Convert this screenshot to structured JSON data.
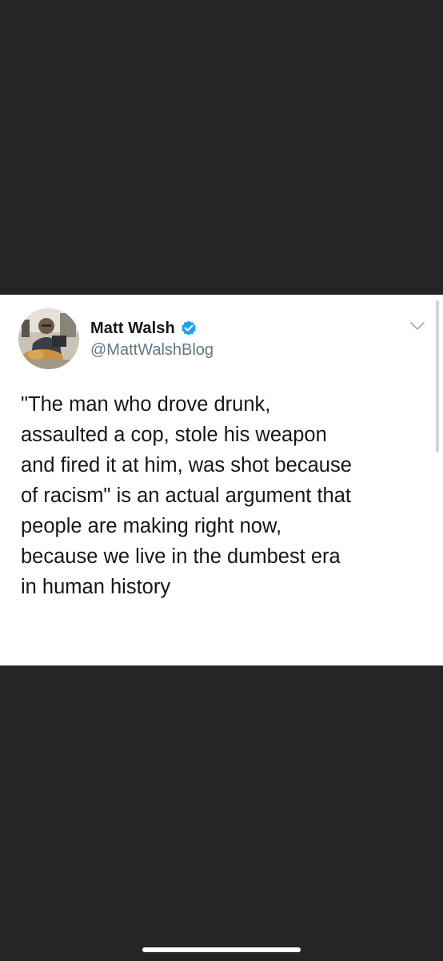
{
  "tweet": {
    "display_name": "Matt Walsh",
    "handle": "@MattWalshBlog",
    "verified": true,
    "text": "\"The man who drove drunk,\nassaulted a cop, stole his weapon\nand fired it at him, was shot because\nof racism\" is an actual argument that\npeople are making right now,\nbecause we live in the dumbest era\nin human history"
  },
  "icons": {
    "verified": "verified-badge-icon",
    "more": "chevron-down-icon",
    "avatar": "avatar-photo"
  },
  "colors": {
    "background": "#252527",
    "card": "#ffffff",
    "name": "#14171a",
    "handle": "#657786",
    "verified": "#1da1f2",
    "home_indicator": "#ffffff"
  }
}
